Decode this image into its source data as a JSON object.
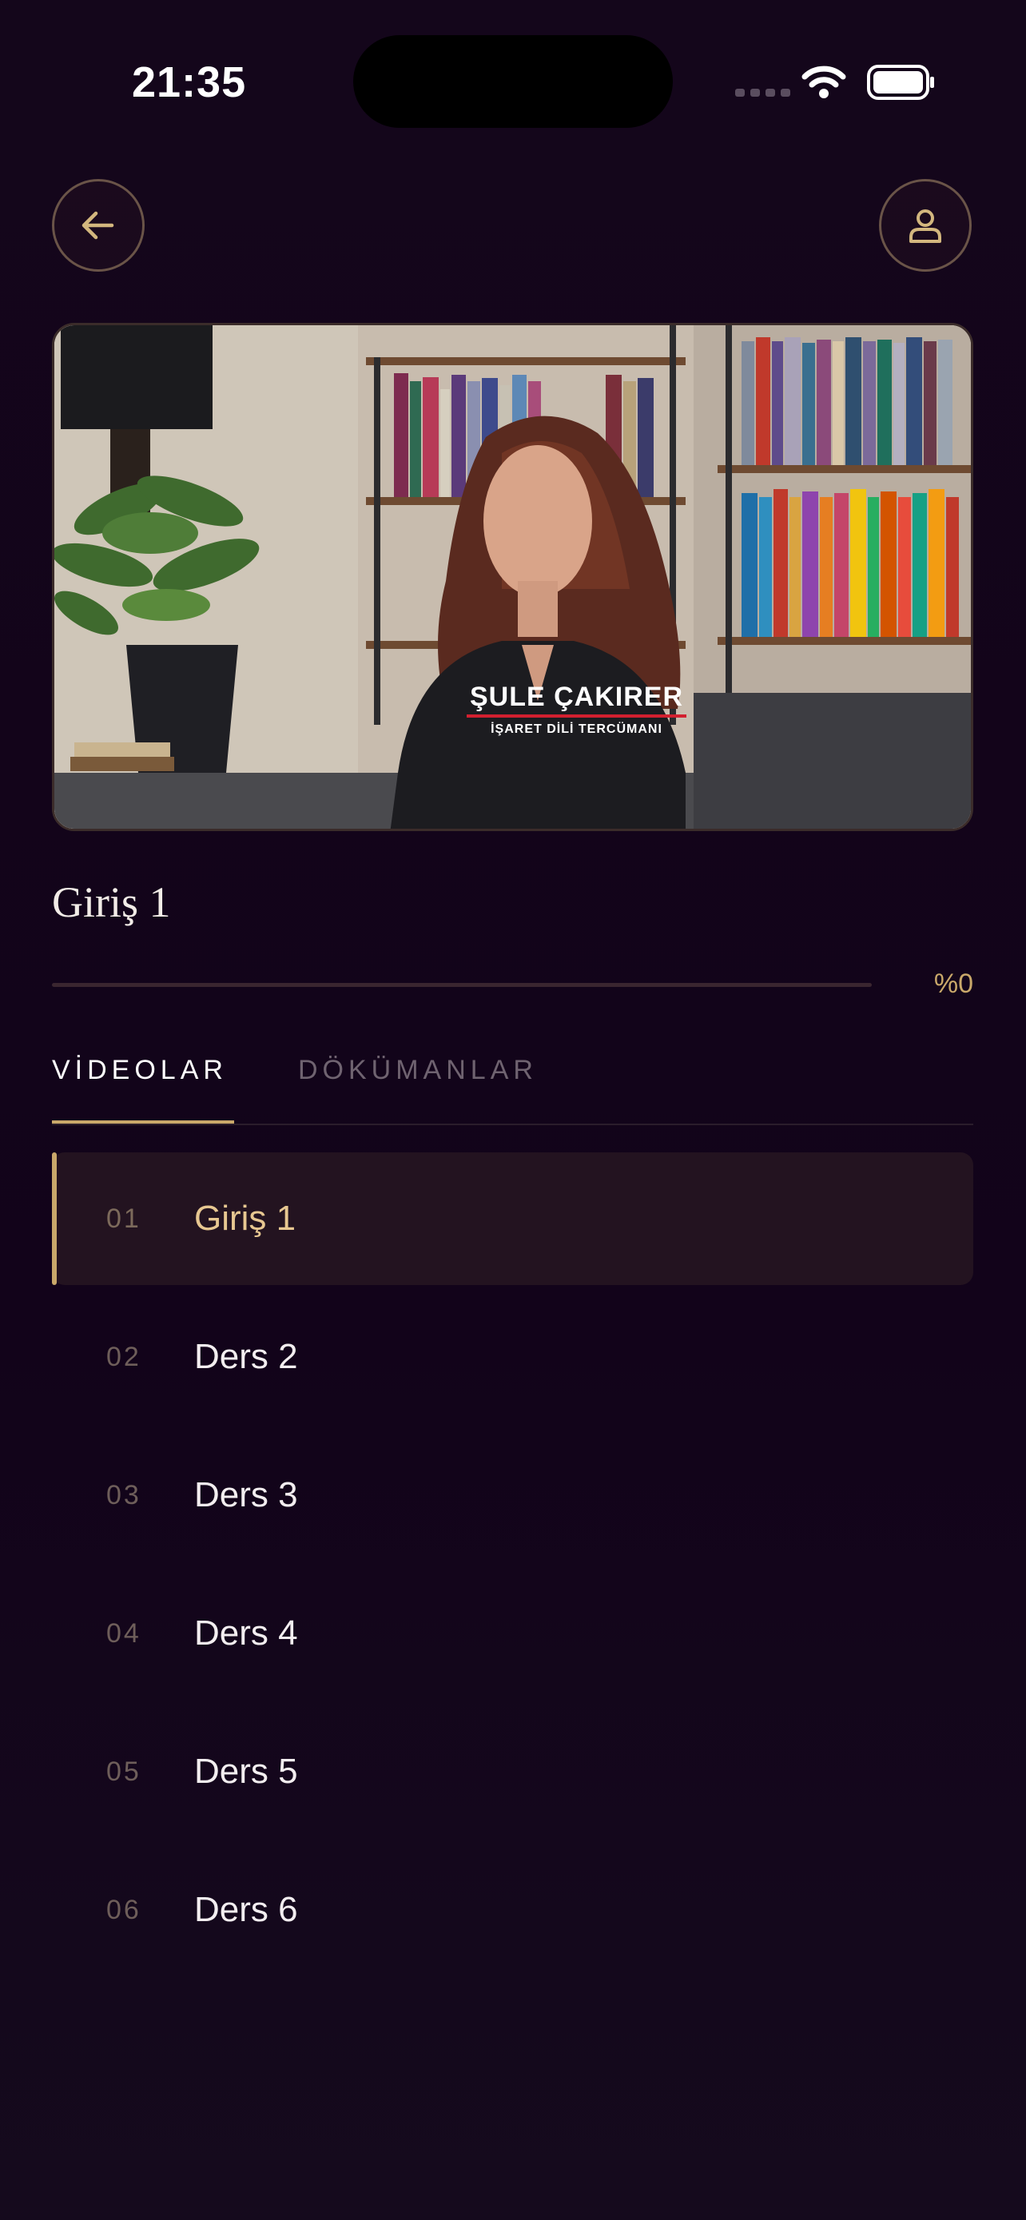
{
  "status_bar": {
    "time": "21:35"
  },
  "header": {
    "back_icon": "arrow-left-icon",
    "profile_icon": "user-icon"
  },
  "video": {
    "caption_name": "ŞULE ÇAKIRER",
    "caption_role": "İŞARET DİLİ TERCÜMANI"
  },
  "lesson": {
    "title": "Giriş 1",
    "progress_label": "%0",
    "progress_fraction": 0
  },
  "tabs": [
    {
      "label": "VİDEOLAR",
      "active": true
    },
    {
      "label": "DÖKÜMANLAR",
      "active": false
    }
  ],
  "lessons": [
    {
      "number": "01",
      "name": "Giriş 1",
      "active": true
    },
    {
      "number": "02",
      "name": "Ders 2",
      "active": false
    },
    {
      "number": "03",
      "name": "Ders 3",
      "active": false
    },
    {
      "number": "04",
      "name": "Ders 4",
      "active": false
    },
    {
      "number": "05",
      "name": "Ders 5",
      "active": false
    },
    {
      "number": "06",
      "name": "Ders 6",
      "active": false
    }
  ],
  "colors": {
    "background": "#13041a",
    "accent": "#c9a86a",
    "active_row": "#231320"
  }
}
